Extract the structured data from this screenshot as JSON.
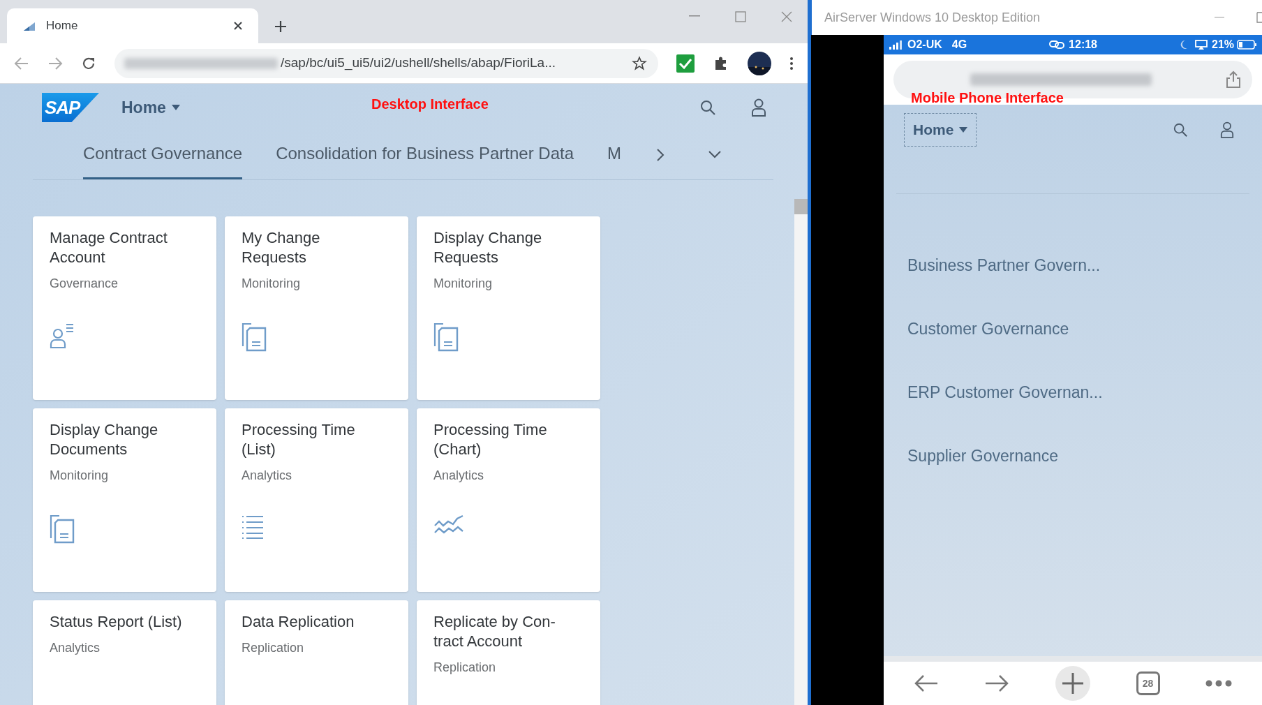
{
  "browser": {
    "tab": {
      "title": "Home"
    },
    "address": {
      "url": "/sap/bc/ui5_ui5/ui2/ushell/shells/abap/FioriLa..."
    }
  },
  "desktop": {
    "annotation": "Desktop Interface",
    "logo": "SAP",
    "home": "Home",
    "tabs": [
      {
        "label": "Contract Governance",
        "selected": true
      },
      {
        "label": "Consolidation for Business Partner Data",
        "selected": false
      },
      {
        "label": "M",
        "selected": false
      }
    ],
    "tiles": [
      {
        "title": "Manage Contract Account",
        "subtitle": "Governance",
        "kind": "person"
      },
      {
        "title": "My Change Requests",
        "subtitle": "Monitoring",
        "kind": "document"
      },
      {
        "title": "Display Change Requests",
        "subtitle": "Monitoring",
        "kind": "document"
      },
      {
        "title": "Display Change Documents",
        "subtitle": "Monitoring",
        "kind": "document"
      },
      {
        "title": "Processing Time (List)",
        "subtitle": "Analytics",
        "kind": "list"
      },
      {
        "title": "Processing Time (Chart)",
        "subtitle": "Analytics",
        "kind": "trend"
      },
      {
        "title": "Status Report (List)",
        "subtitle": "Analytics",
        "kind": "plain"
      },
      {
        "title": "Data Replication",
        "subtitle": "Replication",
        "kind": "plain"
      },
      {
        "title": "Replicate by Con-tract Account",
        "subtitle": "Replication",
        "kind": "plain"
      }
    ]
  },
  "mirror_window": {
    "title": "AirServer Windows 10 Desktop Edition"
  },
  "phone": {
    "status_bar": {
      "carrier": "O2-UK",
      "network": "4G",
      "time": "12:18",
      "battery": "21%"
    },
    "annotation": "Mobile Phone Interface",
    "home": "Home",
    "groups": [
      "Business Partner Govern...",
      "Customer Governance",
      "ERP Customer Governan...",
      "Supplier Governance"
    ],
    "tab_count": "28"
  }
}
